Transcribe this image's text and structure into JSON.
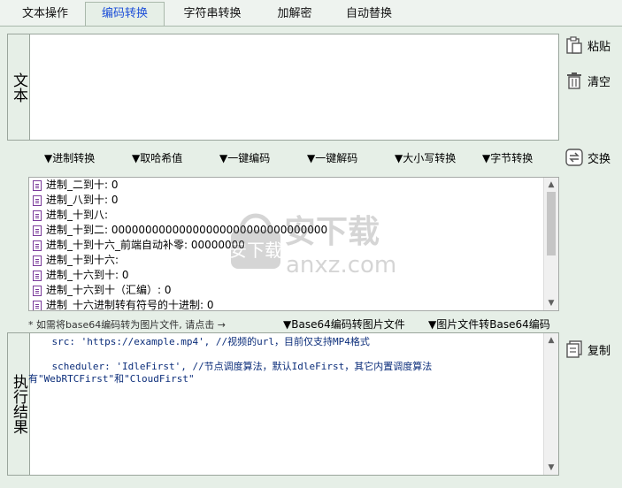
{
  "tabs": [
    {
      "label": "文本操作",
      "active": false
    },
    {
      "label": "编码转换",
      "active": true
    },
    {
      "label": "字符串转换",
      "active": false
    },
    {
      "label": "加解密",
      "active": false
    },
    {
      "label": "自动替换",
      "active": false
    }
  ],
  "text_panel": {
    "label": "文本",
    "value": ""
  },
  "side_buttons": {
    "paste": "粘贴",
    "clear": "清空",
    "swap": "交换",
    "copy": "复制"
  },
  "toolbar": [
    "▼进制转换",
    "▼取哈希值",
    "▼一键编码",
    "▼一键解码",
    "▼大小写转换",
    "▼字节转换"
  ],
  "conversion_list": [
    "进制_二到十: 0",
    "进制_八到十: 0",
    "进制_十到八:",
    "进制_十到二: 00000000000000000000000000000000",
    "进制_十到十六_前端自动补零: 00000000",
    "进制_十到十六:",
    "进制_十六到十: 0",
    "进制_十六到十（汇编）: 0",
    "进制_十六进制转有符号的十进制: 0"
  ],
  "base64": {
    "note": "* 如需将base64编码转为图片文件, 请点击 →",
    "to_image": "▼Base64编码转图片文件",
    "from_image": "▼图片文件转Base64编码"
  },
  "result_panel": {
    "label": "执行结果",
    "text": "    src: 'https://example.mp4', //视频的url，目前仅支持MP4格式\n\n    scheduler: 'IdleFirst', //节点调度算法，默认IdleFirst，其它内置调度算法有\"WebRTCFirst\"和\"CloudFirst\""
  },
  "watermark": {
    "text": "安下载",
    "domain": "anxz.com"
  },
  "colors": {
    "accent": "#1d4fd8",
    "background": "#e6efe7",
    "border": "#9aa59c"
  }
}
